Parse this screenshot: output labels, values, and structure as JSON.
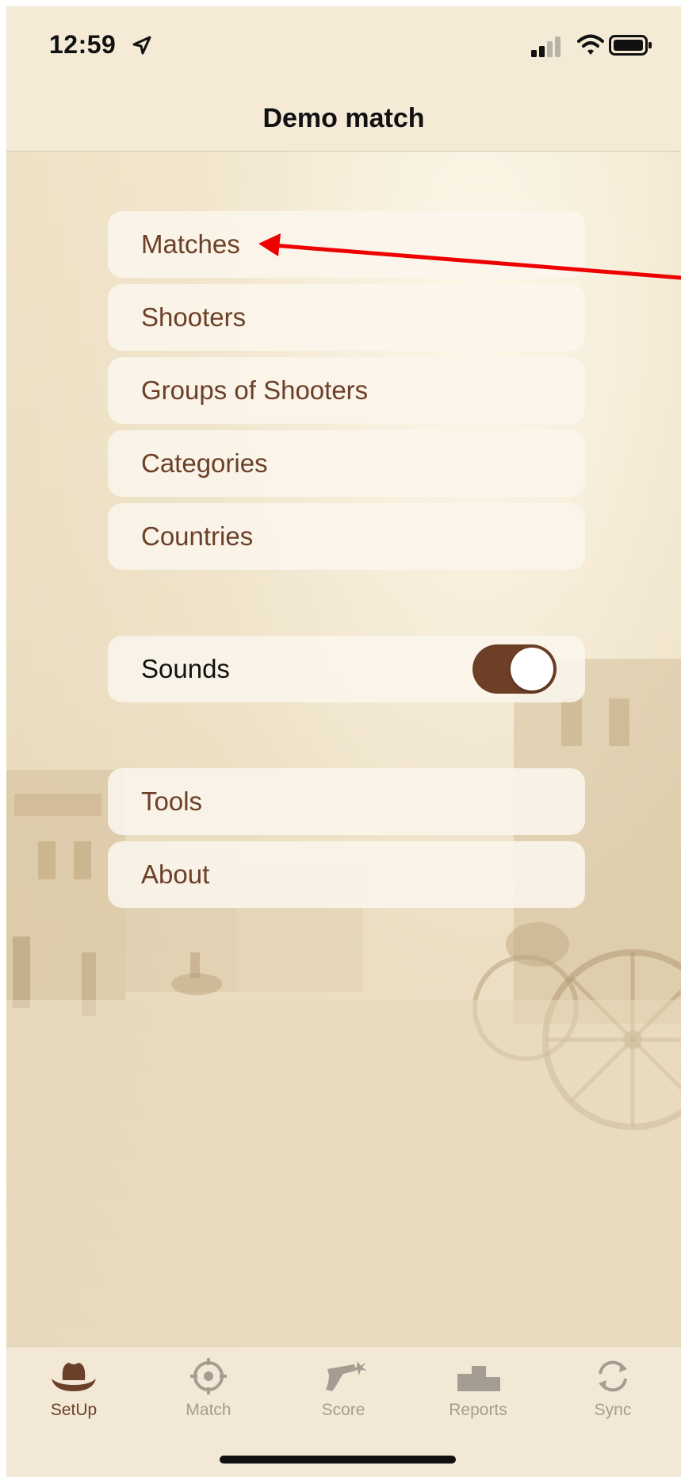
{
  "status_bar": {
    "time": "12:59",
    "icons": [
      "location-arrow-icon",
      "signal-icon",
      "wifi-icon",
      "battery-icon"
    ]
  },
  "nav": {
    "title": "Demo match"
  },
  "menu": {
    "group1": [
      "Matches",
      "Shooters",
      "Groups of Shooters",
      "Categories",
      "Countries"
    ],
    "sounds": {
      "label": "Sounds",
      "enabled": true
    },
    "group2": [
      "Tools",
      "About"
    ]
  },
  "tabs": [
    {
      "label": "SetUp",
      "icon": "cowboy-hat-icon",
      "active": true
    },
    {
      "label": "Match",
      "icon": "crosshair-icon",
      "active": false
    },
    {
      "label": "Score",
      "icon": "revolver-icon",
      "active": false
    },
    {
      "label": "Reports",
      "icon": "podium-icon",
      "active": false
    },
    {
      "label": "Sync",
      "icon": "sync-icon",
      "active": false
    }
  ],
  "colors": {
    "accent": "#6b3f28",
    "toggle_on": "#6d3f27",
    "annotation_arrow": "#ee0000",
    "inactive_tab": "#a59d92"
  }
}
